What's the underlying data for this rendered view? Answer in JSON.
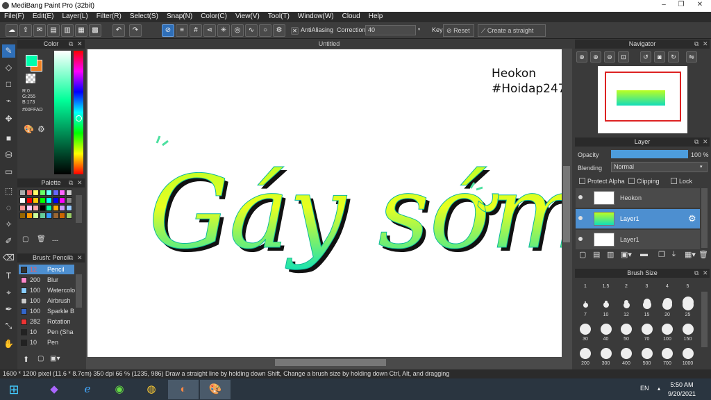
{
  "app": {
    "title": "MediBang Paint Pro (32bit)"
  },
  "window_buttons": {
    "min": "–",
    "max": "❐",
    "close": "✕"
  },
  "menu": [
    "File(F)",
    "Edit(E)",
    "Layer(L)",
    "Filter(R)",
    "Select(S)",
    "Snap(N)",
    "Color(C)",
    "View(V)",
    "Tool(T)",
    "Window(W)",
    "Cloud",
    "Help"
  ],
  "toolbar": {
    "antialiasing_label": "AntiAliasing",
    "correction_label": "Correction",
    "correction_value": "40",
    "key_label": "Key",
    "reset_label": "Reset",
    "straight_line_label": "Create a straight line"
  },
  "color_panel": {
    "title": "Color",
    "r": "R:0",
    "g": "G:255",
    "b": "B:173",
    "hex": "#00FFAD",
    "primary": "#00FFAD",
    "secondary": "#F08020"
  },
  "palette_panel": {
    "title": "Palette",
    "dash": "---",
    "colors": [
      "#aaa",
      "#f66",
      "#ff6",
      "#6f6",
      "#6ff",
      "#66f",
      "#f6f",
      "#ccc",
      "#fff",
      "#f00",
      "#fc0",
      "#0f0",
      "#0ff",
      "#00f",
      "#f0f",
      "#888",
      "#f99",
      "#fcf",
      "#faa",
      "#000",
      "#0f9",
      "#fa0",
      "#c9f",
      "#9cf",
      "#960",
      "#f90",
      "#cf9",
      "#6c9",
      "#39f",
      "#963",
      "#c60",
      "#9c6"
    ]
  },
  "brush_panel": {
    "title": "Brush: Pencil",
    "items": [
      {
        "size": "12",
        "name": "Pencil",
        "color": "#333"
      },
      {
        "size": "200",
        "name": "Blur",
        "color": "#f8c"
      },
      {
        "size": "100",
        "name": "Watercolor",
        "color": "#8cf"
      },
      {
        "size": "100",
        "name": "Airbrush",
        "color": "#ccc"
      },
      {
        "size": "100",
        "name": "Sparkle B",
        "color": "#36c"
      },
      {
        "size": "282",
        "name": "Rotation",
        "color": "#e33"
      },
      {
        "size": "10",
        "name": "Pen (Sha",
        "color": "#222"
      },
      {
        "size": "10",
        "name": "Pen",
        "color": "#222"
      }
    ]
  },
  "document": {
    "title": "Untitled",
    "line1": "Heokon",
    "line2": "#Hoidap247",
    "art_text": "Gáy sớm"
  },
  "navigator": {
    "title": "Navigator"
  },
  "layer_panel": {
    "title": "Layer",
    "opacity_label": "Opacity",
    "opacity_value": "100 %",
    "opacity_fraction": 1.0,
    "blending_label": "Blending",
    "blending_value": "Normal",
    "protect_alpha": "Protect Alpha",
    "clipping": "Clipping",
    "lock": "Lock",
    "layers": [
      {
        "name": "Heokon",
        "selected": false
      },
      {
        "name": "Layer1",
        "selected": true
      },
      {
        "name": "Layer1",
        "selected": false
      }
    ]
  },
  "brush_size_panel": {
    "title": "Brush Size",
    "row1": [
      "1",
      "1.5",
      "2",
      "3",
      "4",
      "5"
    ],
    "row2": [
      "7",
      "10",
      "12",
      "15",
      "20",
      "25"
    ],
    "row3": [
      "30",
      "40",
      "50",
      "70",
      "100",
      "150"
    ],
    "row4": [
      "200",
      "300",
      "400",
      "500",
      "700",
      "1000"
    ]
  },
  "status": {
    "text": "1600 * 1200 pixel  (11.6 * 8.7cm)  350 dpi  66 %  (1235, 986)  Draw a straight line by holding down Shift, Change a brush size by holding down Ctrl, Alt, and dragging"
  },
  "taskbar": {
    "lang": "EN",
    "time": "5:50 AM",
    "date": "9/20/2021"
  }
}
